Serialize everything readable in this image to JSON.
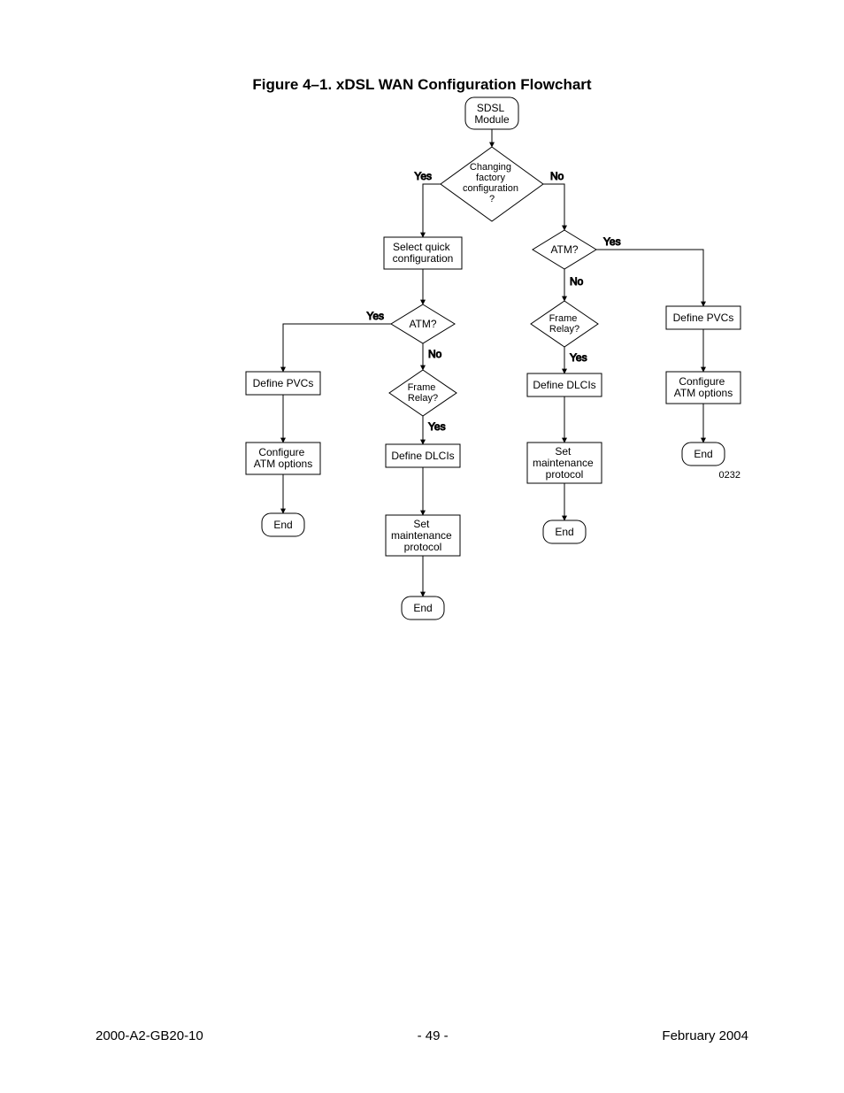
{
  "title": "Figure 4–1.  xDSL WAN Configuration Flowchart",
  "nodes": {
    "start": "SDSL Module",
    "d_changing": "Changing factory configuration ?",
    "p_select_quick": "Select quick configuration",
    "d_atm_left": "ATM?",
    "d_fr_left": "Frame Relay?",
    "p_define_pvcs_left": "Define PVCs",
    "p_cfg_atm_left": "Configure ATM options",
    "t_end_left": "End",
    "p_define_dlcis_mid": "Define DLCIs",
    "p_set_maint_mid": "Set maintenance protocol",
    "t_end_mid": "End",
    "d_atm_right": "ATM?",
    "d_fr_right": "Frame Relay?",
    "p_define_dlcis_right": "Define DLCIs",
    "p_set_maint_right": "Set maintenance protocol",
    "t_end_right": "End",
    "p_define_pvcs_far": "Define PVCs",
    "p_cfg_atm_far": "Configure ATM options",
    "t_end_far": "End",
    "diagram_id": "0232"
  },
  "edge_labels": {
    "yes": "Yes",
    "no": "No"
  },
  "footer": {
    "left": "2000-A2-GB20-10",
    "center": "- 49 -",
    "right": "February 2004"
  }
}
